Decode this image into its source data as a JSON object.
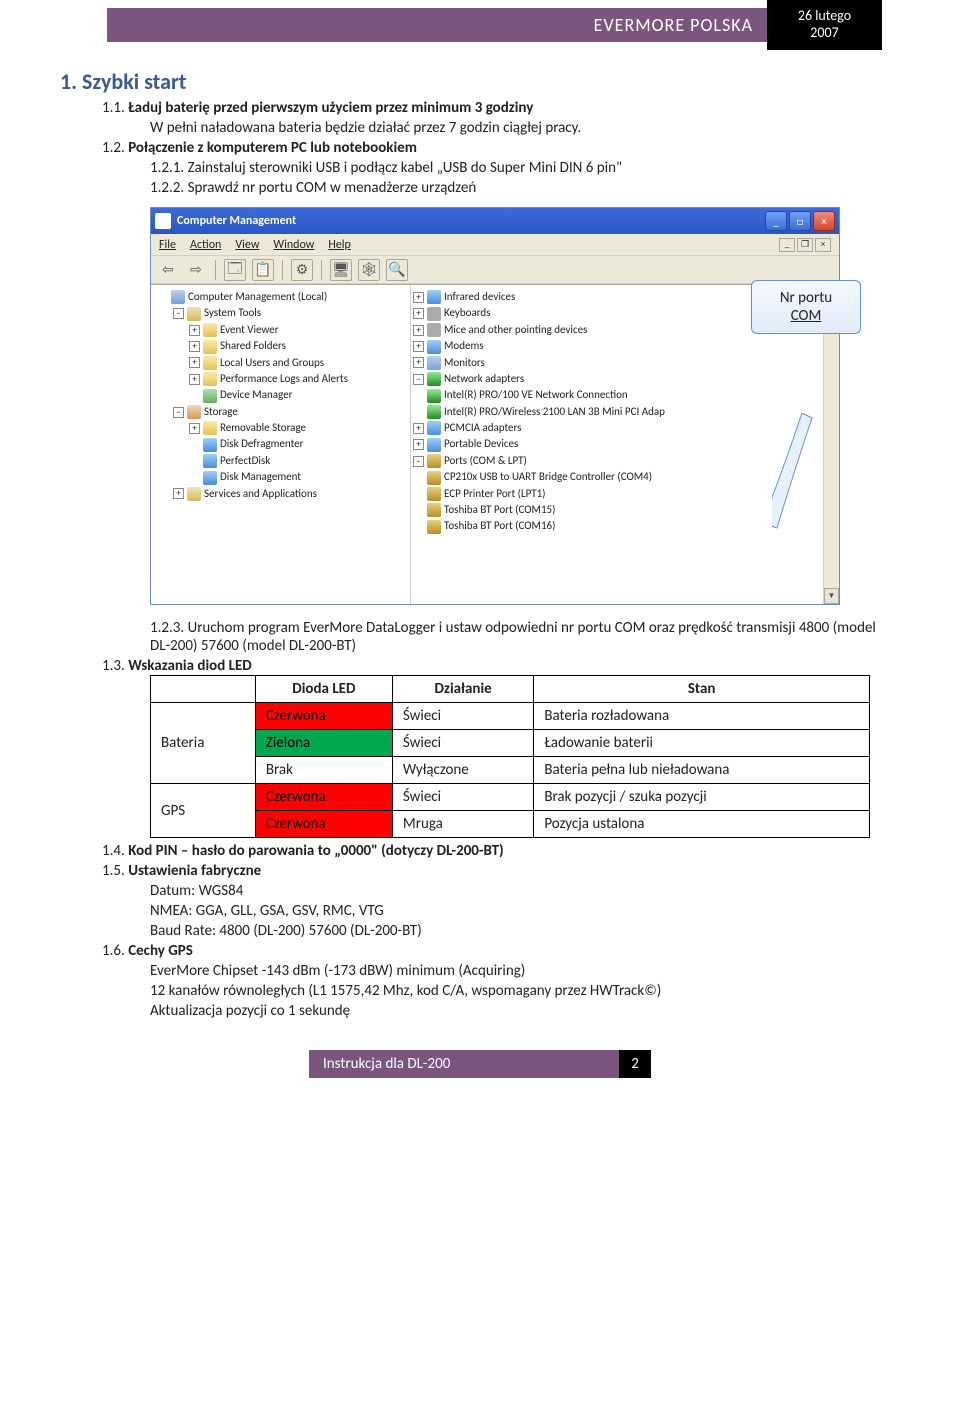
{
  "banner": {
    "brand": "EVERMORE POLSKA",
    "date_line1": "26 lutego",
    "date_line2": "2007"
  },
  "h1": "1. Szybki start",
  "s11": {
    "num": "1.1.",
    "title": "Ładuj baterię przed pierwszym użyciem przez minimum 3 godziny",
    "body": "W pełni naładowana bateria będzie działać przez 7 godzin ciągłej pracy."
  },
  "s12": {
    "num": "1.2.",
    "title": "Połączenie z komputerem PC lub notebookiem"
  },
  "s121": {
    "num": "1.2.1.",
    "body": "Zainstaluj sterowniki USB i podłącz kabel „USB do Super Mini DIN 6 pin\""
  },
  "s122": {
    "num": "1.2.2.",
    "body": "Sprawdź nr portu COM w menadżerze urządzeń"
  },
  "callout": {
    "line1": "Nr portu",
    "line2": "COM"
  },
  "win": {
    "title": "Computer Management",
    "menu": [
      "File",
      "Action",
      "View",
      "Window",
      "Help"
    ],
    "left_tree": [
      {
        "lvl": 0,
        "exp": "",
        "icon": "ic-monitor",
        "label": "Computer Management (Local)"
      },
      {
        "lvl": 1,
        "exp": "−",
        "icon": "ic-tools",
        "label": "System Tools"
      },
      {
        "lvl": 2,
        "exp": "+",
        "icon": "ic-folder",
        "label": "Event Viewer"
      },
      {
        "lvl": 2,
        "exp": "+",
        "icon": "ic-folder",
        "label": "Shared Folders"
      },
      {
        "lvl": 2,
        "exp": "+",
        "icon": "ic-folder",
        "label": "Local Users and Groups"
      },
      {
        "lvl": 2,
        "exp": "+",
        "icon": "ic-folder",
        "label": "Performance Logs and Alerts"
      },
      {
        "lvl": 2,
        "exp": "",
        "icon": "ic-dm",
        "label": "Device Manager"
      },
      {
        "lvl": 1,
        "exp": "−",
        "icon": "ic-store",
        "label": "Storage"
      },
      {
        "lvl": 2,
        "exp": "+",
        "icon": "ic-folder",
        "label": "Removable Storage"
      },
      {
        "lvl": 2,
        "exp": "",
        "icon": "ic-blue",
        "label": "Disk Defragmenter"
      },
      {
        "lvl": 2,
        "exp": "",
        "icon": "ic-blue",
        "label": "PerfectDisk"
      },
      {
        "lvl": 2,
        "exp": "",
        "icon": "ic-blue",
        "label": "Disk Management"
      },
      {
        "lvl": 1,
        "exp": "+",
        "icon": "ic-tools",
        "label": "Services and Applications"
      }
    ],
    "right_tree": [
      {
        "lvl": 0,
        "exp": "+",
        "icon": "ic-blue",
        "label": "Infrared devices"
      },
      {
        "lvl": 0,
        "exp": "+",
        "icon": "ic-kb",
        "label": "Keyboards"
      },
      {
        "lvl": 0,
        "exp": "+",
        "icon": "ic-kb",
        "label": "Mice and other pointing devices"
      },
      {
        "lvl": 0,
        "exp": "+",
        "icon": "ic-blue",
        "label": "Modems"
      },
      {
        "lvl": 0,
        "exp": "+",
        "icon": "ic-monitor",
        "label": "Monitors"
      },
      {
        "lvl": 0,
        "exp": "−",
        "icon": "ic-net",
        "label": "Network adapters"
      },
      {
        "lvl": 1,
        "exp": "",
        "icon": "ic-net",
        "label": "Intel(R) PRO/100 VE Network Connection"
      },
      {
        "lvl": 1,
        "exp": "",
        "icon": "ic-net",
        "label": "Intel(R) PRO/Wireless 2100 LAN 3B Mini PCI Adap"
      },
      {
        "lvl": 0,
        "exp": "+",
        "icon": "ic-blue",
        "label": "PCMCIA adapters"
      },
      {
        "lvl": 0,
        "exp": "+",
        "icon": "ic-blue",
        "label": "Portable Devices"
      },
      {
        "lvl": 0,
        "exp": "−",
        "icon": "ic-port",
        "label": "Ports (COM & LPT)"
      },
      {
        "lvl": 1,
        "exp": "",
        "icon": "ic-port",
        "label": "CP210x USB to UART Bridge Controller (COM4)"
      },
      {
        "lvl": 1,
        "exp": "",
        "icon": "ic-port",
        "label": "ECP Printer Port (LPT1)"
      },
      {
        "lvl": 1,
        "exp": "",
        "icon": "ic-port",
        "label": "Toshiba BT Port (COM15)"
      },
      {
        "lvl": 1,
        "exp": "",
        "icon": "ic-port",
        "label": "Toshiba BT Port (COM16)"
      }
    ]
  },
  "s123": {
    "num": "1.2.3.",
    "body": "Uruchom program EverMore DataLogger i ustaw odpowiedni nr portu COM oraz prędkość transmisji  4800 (model DL-200) 57600 (model DL-200-BT)"
  },
  "s13": {
    "num": "1.3.",
    "title": "Wskazania diod LED"
  },
  "table": {
    "headers": [
      "",
      "Dioda LED",
      "Działanie",
      "Stan"
    ],
    "rows": [
      {
        "group": "Bateria",
        "color": "Czerwona",
        "css": "c-red",
        "action": "Świeci",
        "state": "Bateria rozładowana"
      },
      {
        "group": "",
        "color": "Zielona",
        "css": "c-green",
        "action": "Świeci",
        "state": "Ładowanie baterii"
      },
      {
        "group": "",
        "color": "Brak",
        "css": "",
        "action": "Wyłączone",
        "state": "Bateria pełna lub nieładowana"
      },
      {
        "group": "GPS",
        "color": "Czerwona",
        "css": "c-red",
        "action": "Świeci",
        "state": "Brak pozycji / szuka pozycji"
      },
      {
        "group": "",
        "color": "Czerwona",
        "css": "c-red",
        "action": "Mruga",
        "state": "Pozycja ustalona"
      }
    ]
  },
  "s14": {
    "num": "1.4.",
    "title": "Kod PIN – hasło do parowania to „0000\" (dotyczy DL-200-BT)"
  },
  "s15": {
    "num": "1.5.",
    "title": "Ustawienia fabryczne",
    "lines": [
      "Datum: WGS84",
      "NMEA: GGA, GLL, GSA, GSV, RMC, VTG",
      "Baud Rate: 4800 (DL-200) 57600 (DL-200-BT)"
    ]
  },
  "s16": {
    "num": "1.6.",
    "title": "Cechy GPS",
    "lines": [
      "EverMore Chipset  -143 dBm (-173 dBW) minimum (Acquiring)",
      "12 kanałów równoległych (L1 1575,42 Mhz, kod C/A, wspomagany przez HWTrack©)",
      "Aktualizacja pozycji co 1 sekundę"
    ]
  },
  "footer": {
    "text": "Instrukcja dla DL-200",
    "page": "2"
  }
}
